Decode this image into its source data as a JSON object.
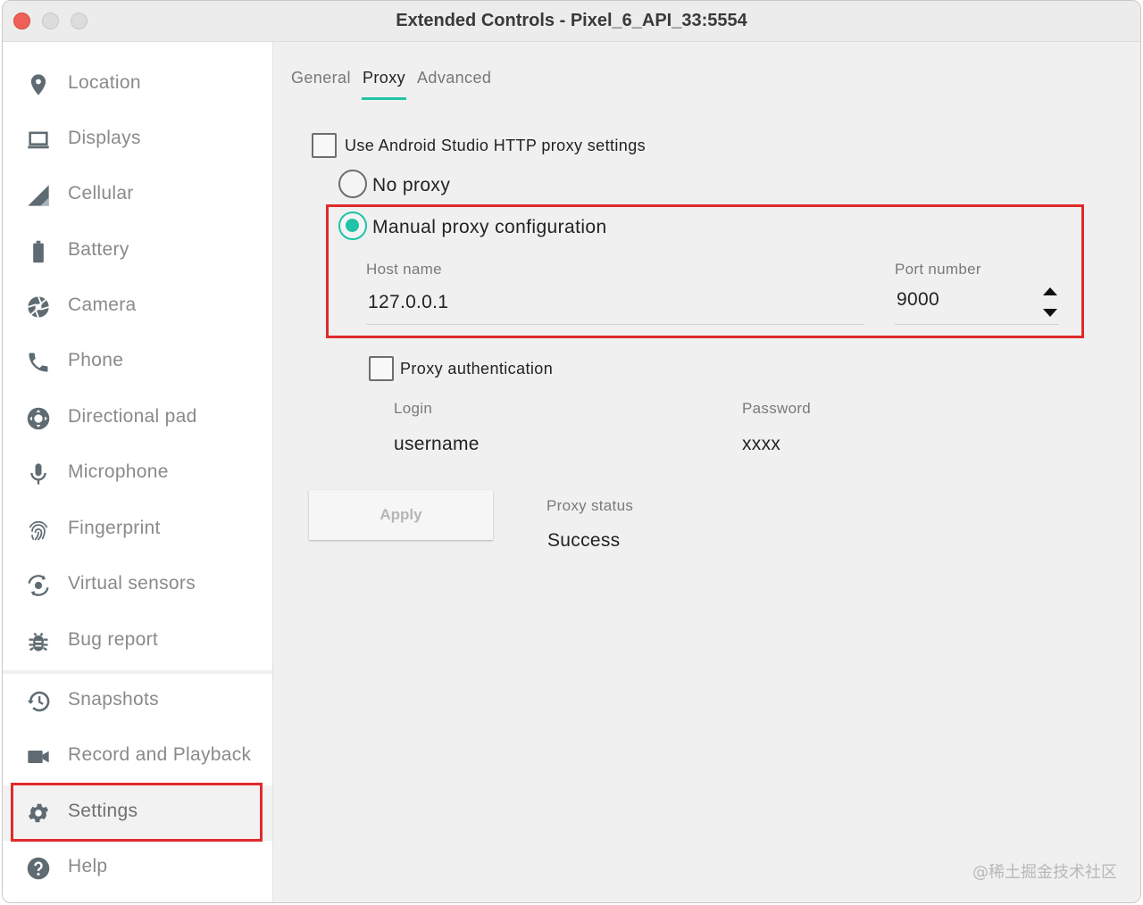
{
  "window": {
    "title": "Extended Controls - Pixel_6_API_33:5554"
  },
  "sidebar": {
    "items": [
      {
        "label": "Location",
        "icon": "location-pin-icon"
      },
      {
        "label": "Displays",
        "icon": "display-icon"
      },
      {
        "label": "Cellular",
        "icon": "cellular-signal-icon"
      },
      {
        "label": "Battery",
        "icon": "battery-icon"
      },
      {
        "label": "Camera",
        "icon": "camera-aperture-icon"
      },
      {
        "label": "Phone",
        "icon": "phone-icon"
      },
      {
        "label": "Directional pad",
        "icon": "dpad-icon"
      },
      {
        "label": "Microphone",
        "icon": "microphone-icon"
      },
      {
        "label": "Fingerprint",
        "icon": "fingerprint-icon"
      },
      {
        "label": "Virtual sensors",
        "icon": "rotation-icon"
      },
      {
        "label": "Bug report",
        "icon": "bug-icon"
      }
    ],
    "bottom_items": [
      {
        "label": "Snapshots",
        "icon": "history-icon"
      },
      {
        "label": "Record and Playback",
        "icon": "video-camera-icon"
      },
      {
        "label": "Settings",
        "icon": "gear-icon"
      },
      {
        "label": "Help",
        "icon": "help-icon"
      }
    ],
    "selected": "Settings"
  },
  "tabs": {
    "general": "General",
    "proxy": "Proxy",
    "advanced": "Advanced",
    "active": "Proxy"
  },
  "proxy": {
    "use_studio_label": "Use Android Studio HTTP proxy settings",
    "use_studio_checked": false,
    "no_proxy_label": "No proxy",
    "manual_label": "Manual proxy configuration",
    "selected_mode": "manual",
    "host_caption": "Host name",
    "host_value": "127.0.0.1",
    "port_caption": "Port number",
    "port_value": "9000",
    "auth_label": "Proxy authentication",
    "auth_checked": false,
    "login_caption": "Login",
    "login_value": "username",
    "password_caption": "Password",
    "password_value": "xxxx",
    "apply_label": "Apply",
    "status_caption": "Proxy status",
    "status_value": "Success"
  },
  "watermark": "@稀土掘金技术社区",
  "colors": {
    "accent": "#1ec3a8",
    "highlight": "#e12a2a",
    "icon": "#5f6b73"
  }
}
